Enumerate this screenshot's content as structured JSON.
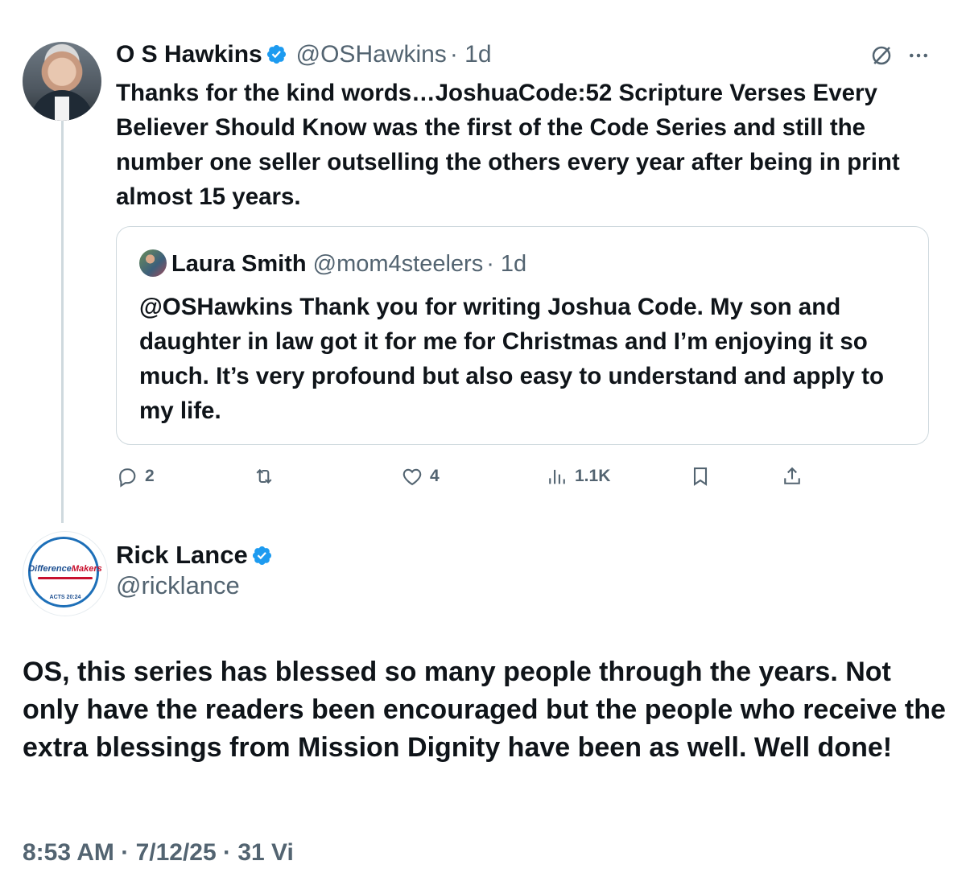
{
  "original_tweet": {
    "author_name": "O S Hawkins",
    "handle": "@OSHawkins",
    "time": "· 1d",
    "text": "Thanks for the kind words…JoshuaCode:52 Scripture Verses Every Believer Should Know was the first of the Code Series and still the number one seller outselling the others every year after being in print almost 15 years.",
    "quoted": {
      "author_name": "Laura Smith",
      "handle": "@mom4steelers",
      "time": "· 1d",
      "text": "@OSHawkins Thank you for writing Joshua Code. My son and daughter in law got it for me for Christmas and I’m enjoying it so much. It’s very profound but also easy to understand and apply to my life."
    },
    "stats": {
      "replies": "2",
      "likes": "4",
      "views": "1.1K"
    }
  },
  "reply_tweet": {
    "author_name": "Rick Lance",
    "handle": "@ricklance",
    "avatar_logo": {
      "part1": "Difference",
      "part2": "Makers",
      "verse": "ACTS 20:24"
    },
    "text": "OS, this series has blessed so many people through the years. Not only have the readers been encouraged but the people who receive the extra blessings from Mission Dignity have been as well. Well done!",
    "footer_partial": "8:53 AM · 7/12/25 · 31 Vi"
  },
  "colors": {
    "text": "#0f1419",
    "muted": "#536471",
    "verified": "#1d9bf0",
    "border": "#cfd9de"
  }
}
